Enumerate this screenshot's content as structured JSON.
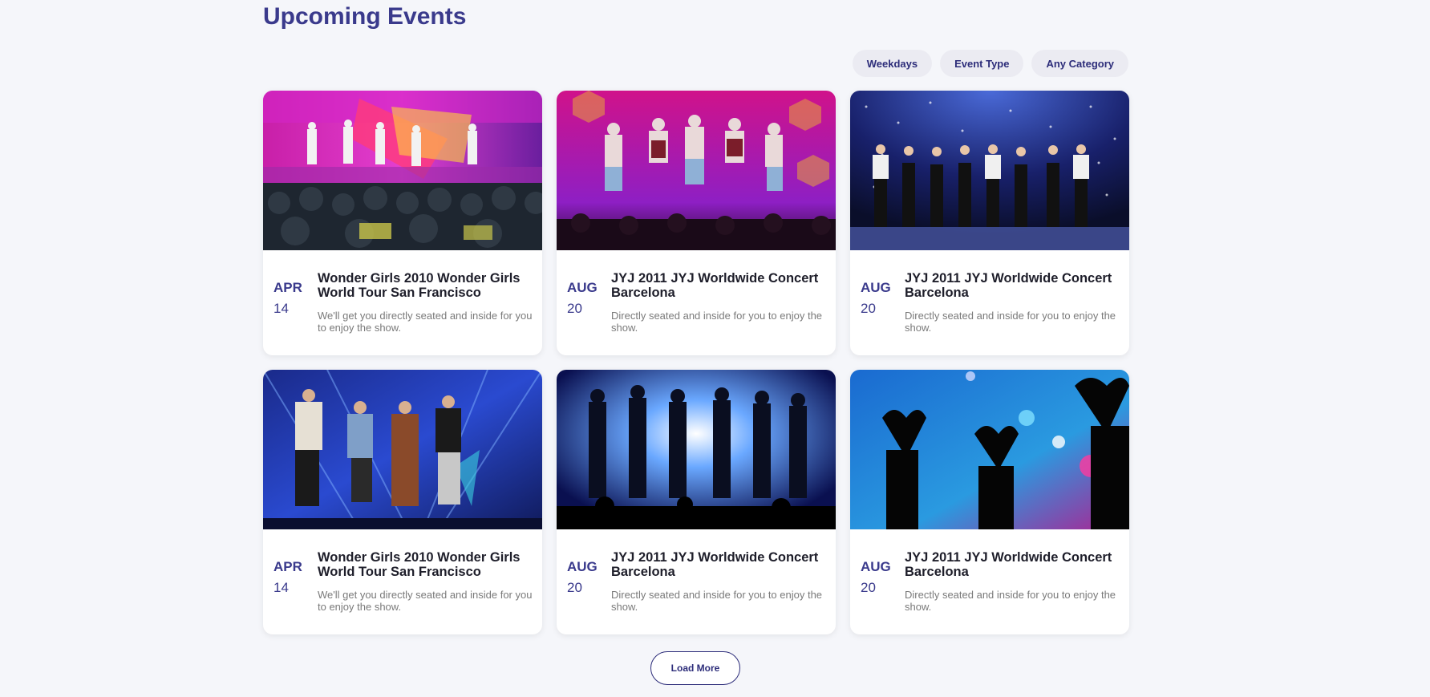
{
  "page": {
    "title": "Upcoming Events"
  },
  "filters": [
    {
      "label": "Weekdays"
    },
    {
      "label": "Event Type"
    },
    {
      "label": "Any Category"
    }
  ],
  "events": [
    {
      "month": "APR",
      "day": "14",
      "title": "Wonder Girls 2010 Wonder Girls World Tour San Francisco",
      "description": "We'll get you directly seated and inside for you to enjoy the show.",
      "image": "concert-stage-pink"
    },
    {
      "month": "AUG",
      "day": "20",
      "title": "JYJ 2011 JYJ Worldwide Concert Barcelona",
      "description": "Directly seated and inside for you to enjoy the show.",
      "image": "concert-jump-magenta"
    },
    {
      "month": "AUG",
      "day": "20",
      "title": "JYJ 2011 JYJ Worldwide Concert Barcelona",
      "description": "Directly seated and inside for you to enjoy the show.",
      "image": "concert-lineup-blue"
    },
    {
      "month": "APR",
      "day": "14",
      "title": "Wonder Girls 2010 Wonder Girls World Tour San Francisco",
      "description": "We'll get you directly seated and inside for you to enjoy the show.",
      "image": "concert-dance-blue"
    },
    {
      "month": "AUG",
      "day": "20",
      "title": "JYJ 2011 JYJ Worldwide Concert Barcelona",
      "description": "Directly seated and inside for you to enjoy the show.",
      "image": "concert-silhouette-light"
    },
    {
      "month": "AUG",
      "day": "20",
      "title": "JYJ 2011 JYJ Worldwide Concert Barcelona",
      "description": "Directly seated and inside for you to enjoy the show.",
      "image": "crowd-hearts-neon"
    }
  ],
  "load_more": {
    "label": "Load More"
  }
}
